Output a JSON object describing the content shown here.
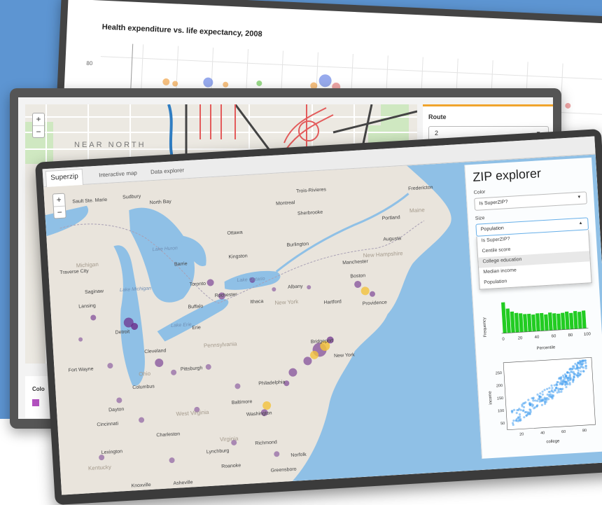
{
  "back_screen": {
    "chart_title": "Health expenditure vs. life expectancy, 2008",
    "y_tick": "80",
    "colors": {
      "point_blue": "#6b86e6",
      "point_orange": "#f2a54a",
      "point_green": "#7fcf6b",
      "point_red": "#e56b6b"
    }
  },
  "mid_screen": {
    "map": {
      "zoom_in": "+",
      "zoom_out": "−",
      "neighborhood_label": "NEAR NORTH"
    },
    "route": {
      "label": "Route",
      "value": "2",
      "caret": "▼"
    },
    "legend": {
      "title": "Colo"
    },
    "colors": {
      "accent": "#f0a42d",
      "route_red": "#e35b5b",
      "legend_purple": "#b351c0"
    }
  },
  "front_screen": {
    "tabs": [
      "Superzip",
      "Interactive map",
      "Data explorer"
    ],
    "map": {
      "zoom_in": "+",
      "zoom_out": "−",
      "places": [
        "Sudbury",
        "North Bay",
        "Montreal",
        "Sherbrooke",
        "Ottawa",
        "Kingston",
        "Burlington",
        "Toronto",
        "Rochester",
        "Buffalo",
        "Albany",
        "Boston",
        "Providence",
        "Hartford",
        "New York",
        "Bridgeport",
        "Philadelphia",
        "Washington",
        "Baltimore",
        "Pittsburgh",
        "Cleveland",
        "Detroit",
        "Columbus",
        "Cincinnati",
        "Dayton",
        "Charleston",
        "Lynchburg",
        "Richmond",
        "Norfolk",
        "Greensboro",
        "Knoxville",
        "Asheville",
        "Augusta",
        "Portland",
        "Lansing",
        "Fort Wayne",
        "Fredericton",
        "Trois-Rivieres",
        "Barrie",
        "Erie",
        "Ithaca",
        "Manchester",
        "Traverse City",
        "Saginaw",
        "Sault Ste. Marie",
        "Lexington",
        "Roanoke"
      ],
      "water_labels": [
        "Lake Huron",
        "Lake Michigan",
        "Lake Ontario",
        "Lake Erie"
      ],
      "state_labels": [
        "Michigan",
        "Pennsylvania",
        "New York",
        "West Virginia",
        "Virginia",
        "Ohio",
        "Kentucky",
        "New Hampshire",
        "Maine"
      ]
    },
    "panel": {
      "title": "ZIP explorer",
      "color_label": "Color",
      "color_value": "Is SuperZIP?",
      "size_label": "Size",
      "size_value": "Population",
      "caret_down": "▼",
      "caret_up": "▲",
      "size_options": [
        "Is SuperZIP?",
        "Centile score",
        "College education",
        "Median income",
        "Population"
      ],
      "highlighted_option": "College education"
    },
    "histogram": {
      "ylabel": "Frequency",
      "xlabel": "Percentile",
      "xticks": [
        "0",
        "20",
        "40",
        "60",
        "80",
        "100"
      ],
      "values": [
        95,
        75,
        65,
        60,
        58,
        55,
        55,
        52,
        55,
        55,
        50,
        55,
        52,
        50,
        52,
        55,
        50,
        55,
        52,
        55
      ]
    },
    "scatter": {
      "ylabel": "income",
      "xlabel": "college",
      "xticks": [
        "20",
        "40",
        "60",
        "80"
      ],
      "yticks": [
        "50",
        "100",
        "150",
        "200",
        "250"
      ]
    },
    "colors": {
      "histogram": "#22cc22",
      "scatter": "#4aa3f0",
      "dot_purple": "#6a2b8a",
      "dot_yellow": "#f2c23c",
      "water": "#8fc0e6",
      "land": "#e9e4dc"
    }
  }
}
